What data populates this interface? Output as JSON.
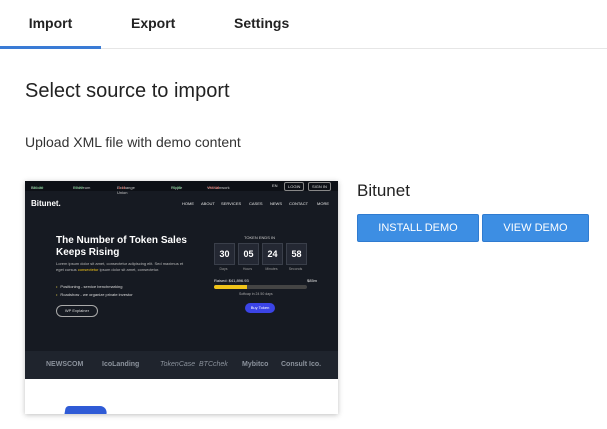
{
  "tabs": [
    {
      "label": "Import",
      "active": true
    },
    {
      "label": "Export",
      "active": false
    },
    {
      "label": "Settings",
      "active": false
    }
  ],
  "main": {
    "heading": "Select source to import",
    "subtext": "Upload XML file with demo content"
  },
  "demo": {
    "name": "Bitunet",
    "install_label": "INSTALL DEMO",
    "view_label": "VIEW DEMO"
  },
  "preview": {
    "ticker": [
      {
        "name": "Bitcoin",
        "value": "+10.00",
        "trend": "up"
      },
      {
        "name": "Ethereum",
        "value": "+6.22",
        "trend": "up"
      },
      {
        "name": "Exchange Union",
        "value": "-1.11",
        "trend": "down"
      },
      {
        "name": "Ripple",
        "value": "+9.25",
        "trend": "up"
      },
      {
        "name": "Vechainwork",
        "value": "+53.08",
        "trend": "down"
      }
    ],
    "top_buttons": [
      "EN",
      "LOGIN",
      "SIGN IN"
    ],
    "logo": "Bitunet.",
    "menu": [
      "HOME",
      "ABOUT",
      "SERVICES",
      "CASES",
      "NEWS",
      "CONTACT",
      "MORE"
    ],
    "hero_title": "The Number of Token Sales Keeps Rising",
    "hero_desc_1": "Lorem ipsum dolor sit amet, consectetur adipiscing elit. Sed maximus et eget cursus",
    "hero_highlight": "consectetur",
    "hero_desc_2": "ipsum dolor sit amet, consectetur.",
    "bullets": [
      "Positioning - service benchmarking",
      "Roadshow - we organize private investor"
    ],
    "wp_button": "WP Explainer",
    "token_label": "TOKEN ENDS IN",
    "countdown": [
      {
        "value": "30",
        "label": "Days"
      },
      {
        "value": "05",
        "label": "Hours"
      },
      {
        "value": "24",
        "label": "Minutes"
      },
      {
        "value": "58",
        "label": "Seconds"
      }
    ],
    "raised_label": "Raised: $41,896.93",
    "raised_right": "$85m",
    "raised_progress": 0.35,
    "softcap": "Softcap in 24 50 days",
    "buy_button": "Buy Token",
    "partners": [
      "NEWSCOM",
      "IcoLanding",
      "TokenCase",
      "BTCchek",
      "Mybitco",
      "Consult Ico."
    ]
  },
  "colors": {
    "accent": "#3a7bd5",
    "button": "#3d8ee3",
    "preview_bg": "#161a22",
    "highlight": "#f0c419"
  }
}
